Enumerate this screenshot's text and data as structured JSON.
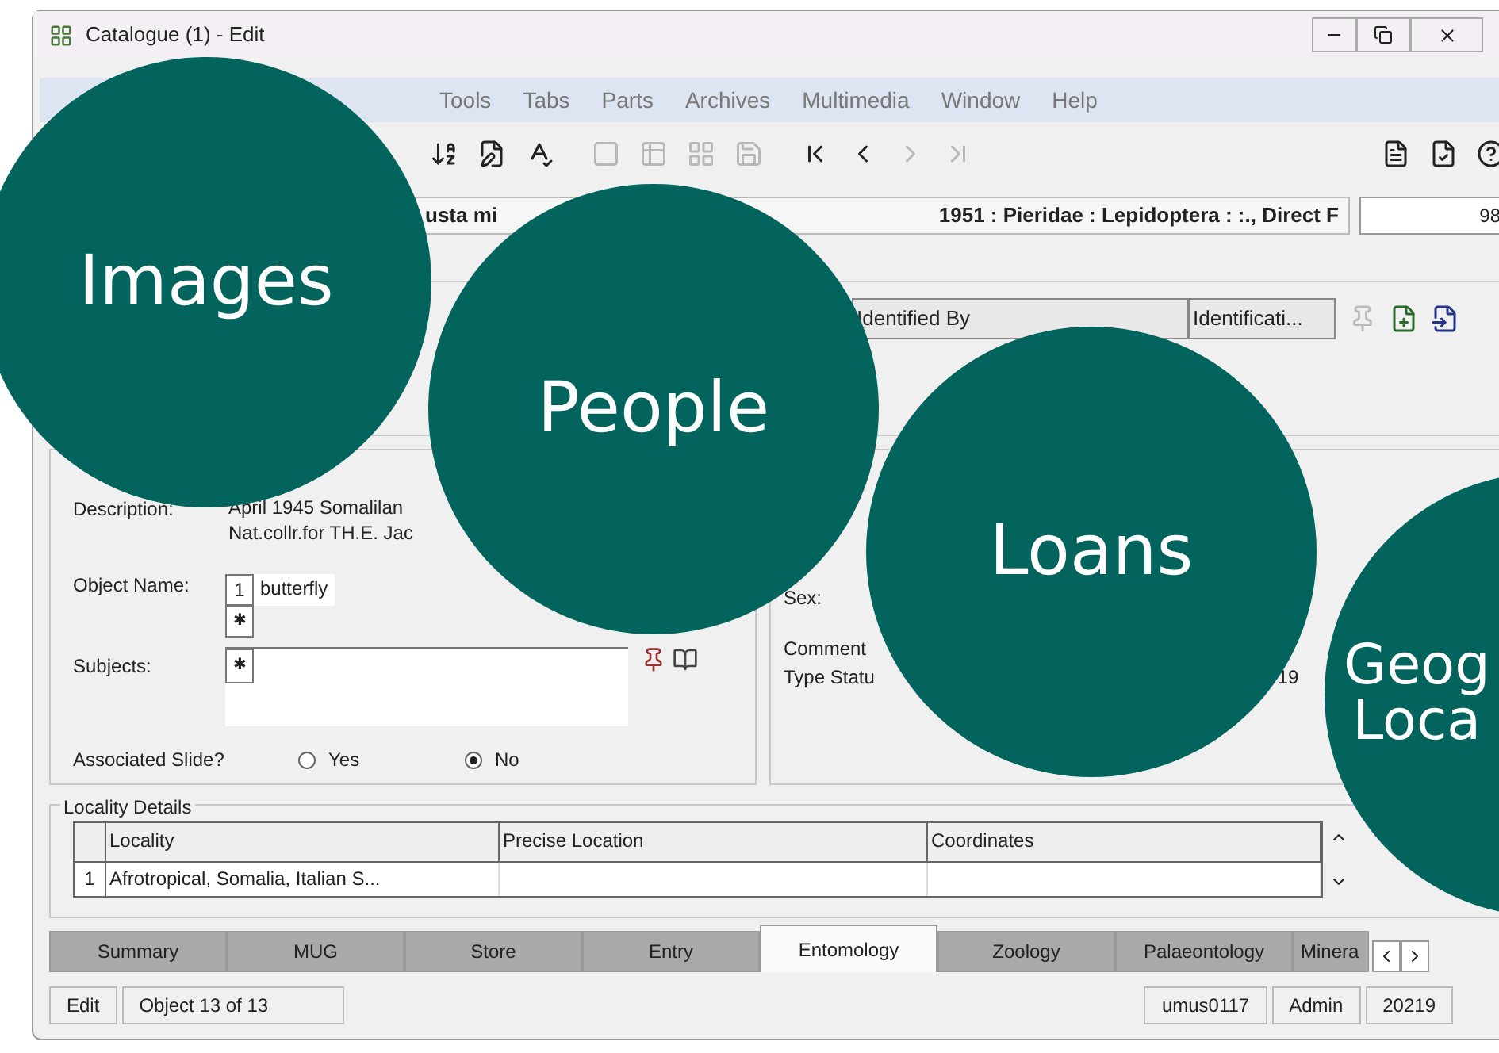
{
  "window": {
    "title": "Catalogue (1) - Edit"
  },
  "menu": [
    "Tools",
    "Tabs",
    "Parts",
    "Archives",
    "Multimedia",
    "Window",
    "Help"
  ],
  "toolbar": [
    {
      "disabled": false
    },
    {
      "disabled": false
    },
    {
      "disabled": false
    },
    {
      "disabled": true
    },
    {
      "disabled": true
    },
    {
      "disabled": true
    },
    {
      "disabled": true
    },
    {
      "disabled": false
    },
    {
      "disabled": false
    },
    {
      "disabled": true
    },
    {
      "disabled": true
    },
    {
      "disabled": false
    },
    {
      "disabled": false
    },
    {
      "disabled": false
    }
  ],
  "record": {
    "summary_start": "usta mi",
    "summary_end": "1951 : Pieridae : Lepidoptera : :., Direct F",
    "count": "98"
  },
  "identification": {
    "columns": [
      "Identified By",
      "Identificati..."
    ]
  },
  "specimen": {
    "description_label": "Description:",
    "description": [
      "April 1945 Somalilan",
      "Nat.collr.for TH.E. Jac"
    ],
    "object_name_label": "Object Name:",
    "object_name_index": "1",
    "object_name": "butterfly",
    "add_mark": "✱",
    "subjects_label": "Subjects:",
    "slide_label": "Associated Slide?",
    "slide_options": [
      {
        "label": "Yes",
        "selected": false
      },
      {
        "label": "No",
        "selected": true
      }
    ]
  },
  "details": {
    "sex_label": "Sex:",
    "comment_label": "Comment",
    "type_label": "Type Statu",
    "type_value": "19"
  },
  "locality": {
    "title": "Locality Details",
    "columns": [
      "Locality",
      "Precise Location",
      "Coordinates"
    ],
    "rows": [
      {
        "index": "1",
        "cells": [
          "Afrotropical, Somalia, Italian S...",
          "",
          ""
        ]
      }
    ]
  },
  "tabs": [
    {
      "label": "Summary",
      "selected": false
    },
    {
      "label": "MUG",
      "selected": false
    },
    {
      "label": "Store",
      "selected": false
    },
    {
      "label": "Entry",
      "selected": false
    },
    {
      "label": "Entomology",
      "selected": true
    },
    {
      "label": "Zoology",
      "selected": false
    },
    {
      "label": "Palaeontology",
      "selected": false
    },
    {
      "label": "Minera",
      "selected": false
    }
  ],
  "status_bar": [
    "Edit",
    "Object 13 of 13",
    "umus0117",
    "Admin",
    "20219"
  ],
  "circles": [
    {
      "label": "Images",
      "kind": "full"
    },
    {
      "label": "People",
      "kind": "full"
    },
    {
      "label": "Loans",
      "kind": "full"
    },
    {
      "label": "Geog\nLoca",
      "kind": "cut"
    }
  ]
}
